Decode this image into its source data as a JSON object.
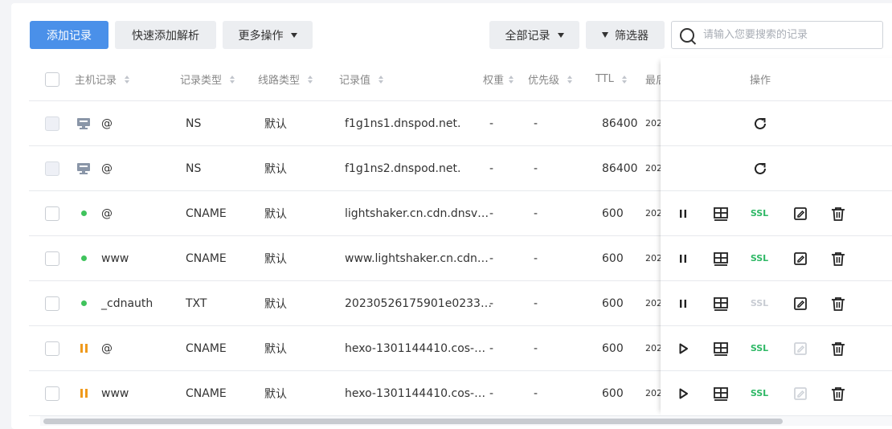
{
  "toolbar": {
    "add_label": "添加记录",
    "quick_label": "快速添加解析",
    "more_label": "更多操作",
    "all_label": "全部记录",
    "filter_label": "筛选器",
    "search_placeholder": "请输入您要搜索的记录"
  },
  "columns": {
    "host": "主机记录",
    "type": "记录类型",
    "line": "线路类型",
    "value": "记录值",
    "weight": "权重",
    "priority": "优先级",
    "ttl": "TTL",
    "updated": "最后",
    "actions": "操作"
  },
  "colors": {
    "primary": "#4a90e9",
    "enabled": "#3fc35c",
    "paused": "#ef9a1d",
    "ssl_active": "#2fb866",
    "ssl_inactive": "#c8ccd3"
  },
  "rows": [
    {
      "status": "system",
      "host": "@",
      "type": "NS",
      "line": "默认",
      "value": "f1g1ns1.dnspod.net.",
      "weight": "-",
      "priority": "-",
      "ttl": "86400",
      "updated": "202",
      "actions": [
        "refresh-icon"
      ]
    },
    {
      "status": "system",
      "host": "@",
      "type": "NS",
      "line": "默认",
      "value": "f1g1ns2.dnspod.net.",
      "weight": "-",
      "priority": "-",
      "ttl": "86400",
      "updated": "202",
      "actions": [
        "refresh-icon"
      ]
    },
    {
      "status": "enabled",
      "host": "@",
      "type": "CNAME",
      "line": "默认",
      "value": "lightshaker.cn.cdn.dnsv…",
      "weight": "-",
      "priority": "-",
      "ttl": "600",
      "updated": "202",
      "toggle": "pause",
      "ssl": "active",
      "edit_enabled": true
    },
    {
      "status": "enabled",
      "host": "www",
      "type": "CNAME",
      "line": "默认",
      "value": "www.lightshaker.cn.cdn…",
      "weight": "-",
      "priority": "-",
      "ttl": "600",
      "updated": "202",
      "toggle": "pause",
      "ssl": "active",
      "edit_enabled": true
    },
    {
      "status": "enabled",
      "host": "_cdnauth",
      "type": "TXT",
      "line": "默认",
      "value": "20230526175901e0233…",
      "weight": "-",
      "priority": "-",
      "ttl": "600",
      "updated": "202",
      "toggle": "pause",
      "ssl": "inactive",
      "edit_enabled": true
    },
    {
      "status": "paused",
      "host": "@",
      "type": "CNAME",
      "line": "默认",
      "value": "hexo-1301144410.cos-…",
      "weight": "-",
      "priority": "-",
      "ttl": "600",
      "updated": "202",
      "toggle": "play",
      "ssl": "active",
      "edit_enabled": false
    },
    {
      "status": "paused",
      "host": "www",
      "type": "CNAME",
      "line": "默认",
      "value": "hexo-1301144410.cos-…",
      "weight": "-",
      "priority": "-",
      "ttl": "600",
      "updated": "202",
      "toggle": "play",
      "ssl": "active",
      "edit_enabled": false
    }
  ],
  "ssl_label": "SSL"
}
